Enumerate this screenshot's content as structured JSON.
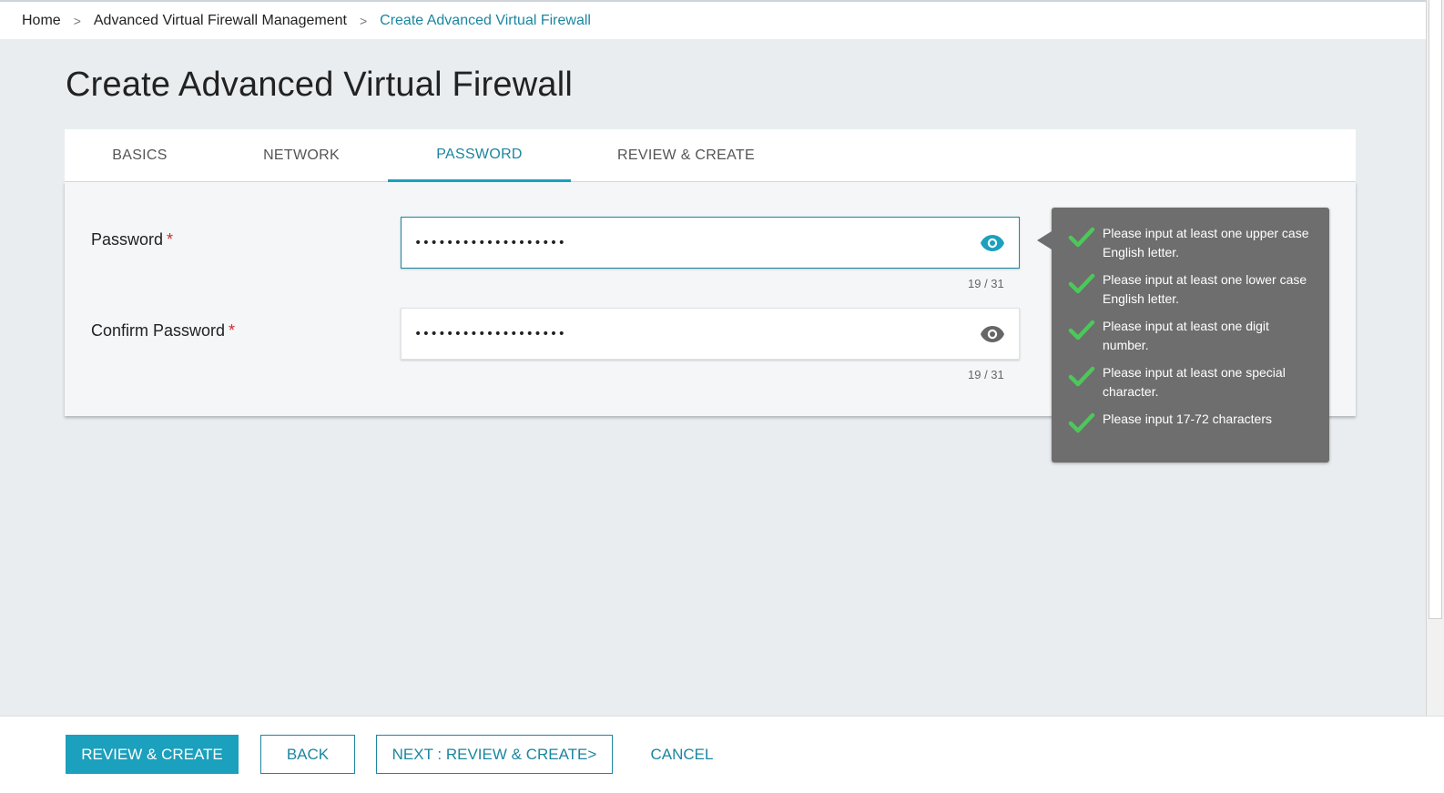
{
  "breadcrumb": {
    "items": [
      "Home",
      "Advanced Virtual Firewall Management",
      "Create Advanced Virtual Firewall"
    ],
    "separator": ">"
  },
  "page": {
    "title": "Create Advanced Virtual Firewall"
  },
  "tabs": [
    {
      "label": "BASICS",
      "active": false
    },
    {
      "label": "NETWORK",
      "active": false
    },
    {
      "label": "PASSWORD",
      "active": true
    },
    {
      "label": "REVIEW & CREATE",
      "active": false
    }
  ],
  "form": {
    "password": {
      "label": "Password",
      "required_mark": "*",
      "value": "•••••••••••••••••••",
      "counter": "19 / 31"
    },
    "confirm_password": {
      "label": "Confirm Password",
      "required_mark": "*",
      "value": "•••••••••••••••••••",
      "counter": "19 / 31"
    }
  },
  "password_rules": [
    {
      "text": "Please input at least one upper case English letter.",
      "satisfied": true
    },
    {
      "text": "Please input at least one lower case English letter.",
      "satisfied": true
    },
    {
      "text": "Please input at least one digit number.",
      "satisfied": true
    },
    {
      "text": "Please input at least one special character.",
      "satisfied": true
    },
    {
      "text": "Please input 17-72 characters",
      "satisfied": true
    }
  ],
  "footer": {
    "review_create": "REVIEW & CREATE",
    "back": "BACK",
    "next": "NEXT : REVIEW & CREATE>",
    "cancel": "CANCEL"
  },
  "icons": {
    "password_visibility": "eye-icon",
    "rule_status": "check-icon"
  },
  "colors": {
    "accent": "#1ba0bd",
    "accent_text": "#1b86a0",
    "required": "#d62a2a",
    "check": "#4cc85a",
    "tooltip_bg": "#6e6e6e",
    "eye_active": "#1ba0bd",
    "eye_inactive": "#666666"
  }
}
